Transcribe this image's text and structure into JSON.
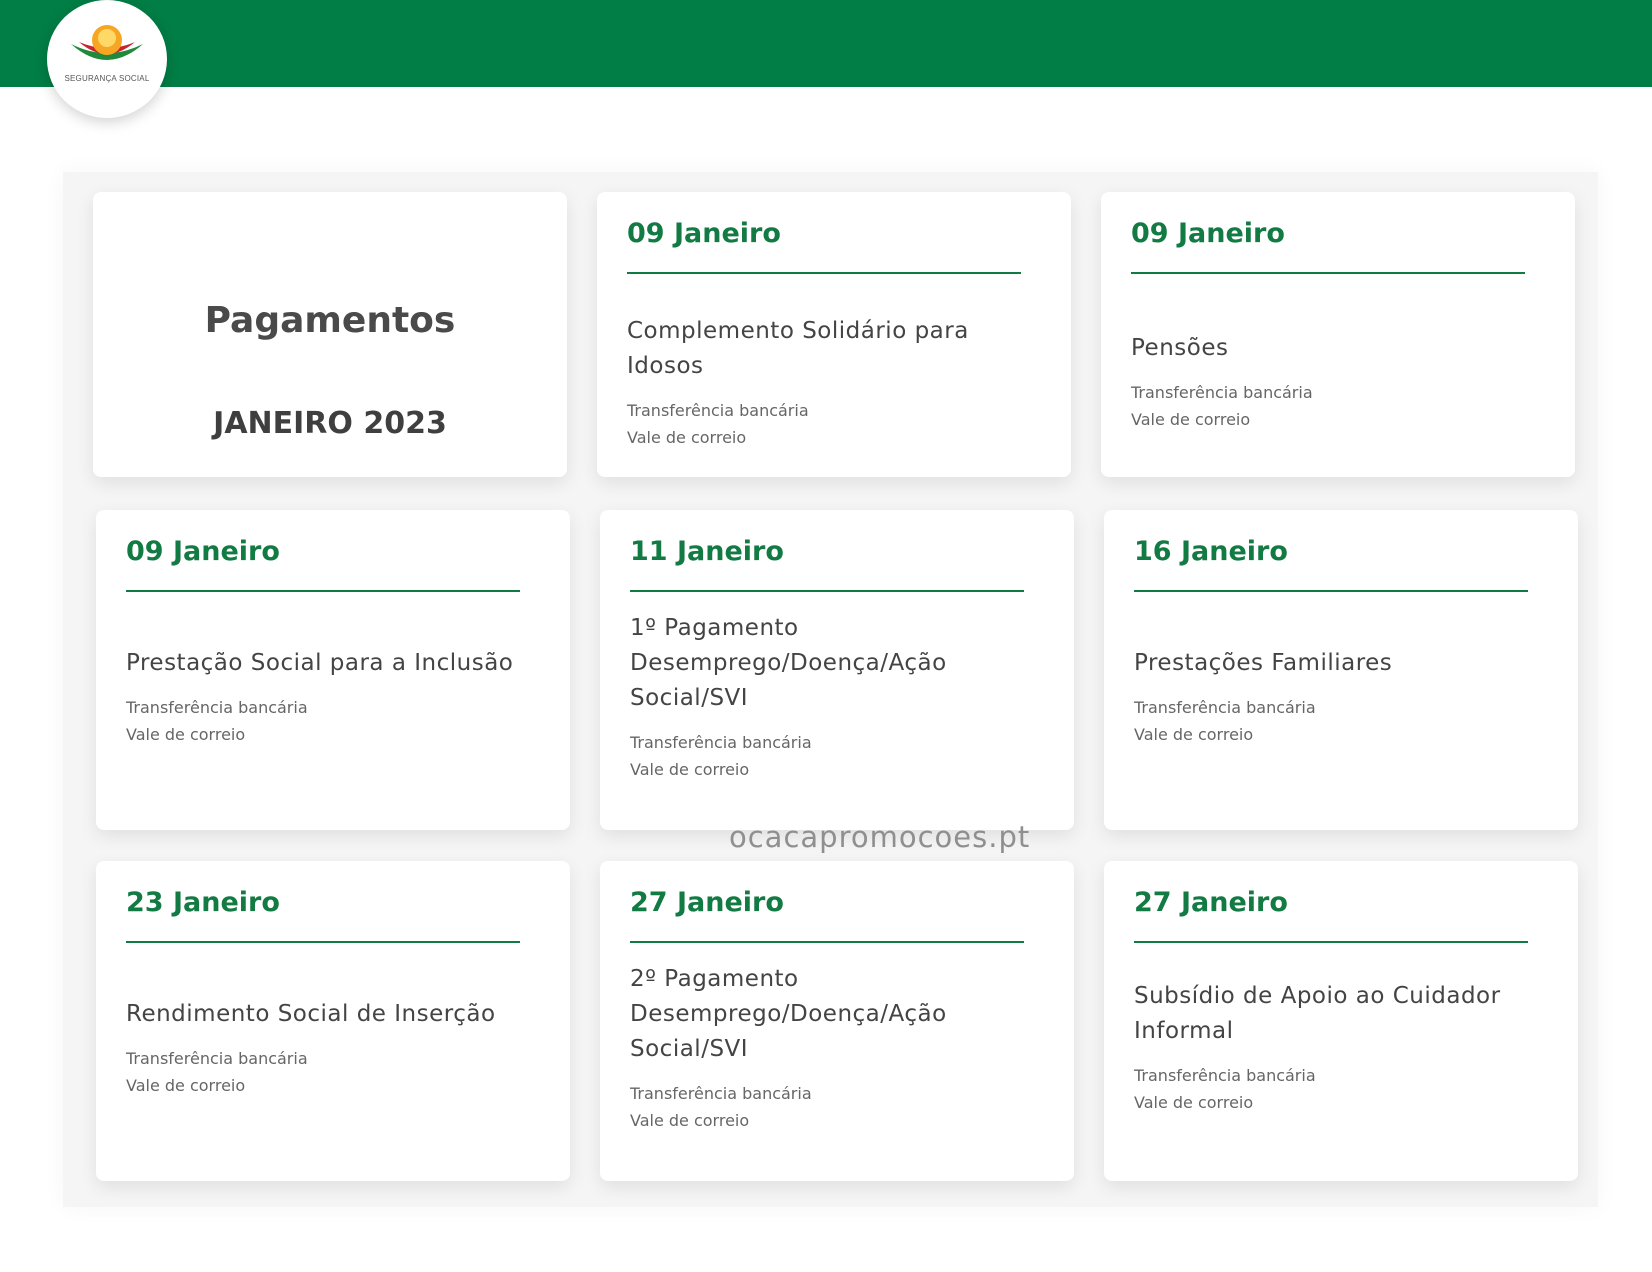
{
  "header": {
    "logo_text": "SEGURANÇA SOCIAL",
    "brand_color": "#007e45",
    "logo_icon": "seguranca-social-logo-icon"
  },
  "hero": {
    "title": "Pagamentos",
    "subtitle": "JANEIRO 2023"
  },
  "cards": [
    {
      "date": "09 Janeiro",
      "title": "Complemento Solidário para Idosos",
      "methods": [
        "Transferência bancária",
        "Vale de correio"
      ]
    },
    {
      "date": "09 Janeiro",
      "title": "Pensões",
      "methods": [
        "Transferência bancária",
        "Vale de correio"
      ]
    },
    {
      "date": "09 Janeiro",
      "title": "Prestação Social para a Inclusão",
      "methods": [
        "Transferência bancária",
        "Vale de correio"
      ]
    },
    {
      "date": "11 Janeiro",
      "title": "1º Pagamento Desemprego/Doença/Ação Social/SVI",
      "methods": [
        "Transferência bancária",
        "Vale de correio"
      ]
    },
    {
      "date": "16 Janeiro",
      "title": "Prestações Familiares",
      "methods": [
        "Transferência bancária",
        "Vale de correio"
      ]
    },
    {
      "date": "23 Janeiro",
      "title": "Rendimento Social de Inserção",
      "methods": [
        "Transferência bancária",
        "Vale de correio"
      ]
    },
    {
      "date": "27 Janeiro",
      "title": "2º Pagamento Desemprego/Doença/Ação Social/SVI",
      "methods": [
        "Transferência bancária",
        "Vale de correio"
      ]
    },
    {
      "date": "27 Janeiro",
      "title": "Subsídio de Apoio ao Cuidador Informal",
      "methods": [
        "Transferência bancária",
        "Vale de correio"
      ]
    }
  ],
  "watermark": "ocacapromocoes.pt"
}
